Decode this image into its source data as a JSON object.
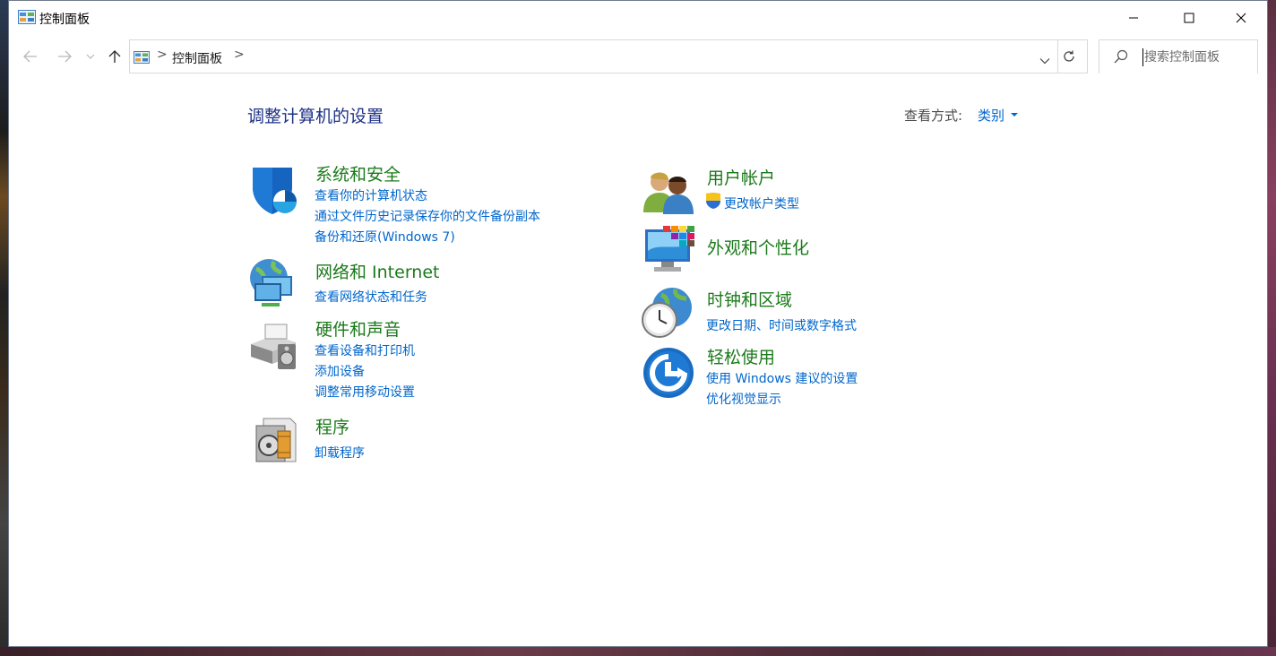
{
  "window": {
    "title": "控制面板"
  },
  "address": {
    "crumb": "控制面板",
    "separator": ">"
  },
  "search": {
    "placeholder": "搜索控制面板"
  },
  "header": {
    "heading": "调整计算机的设置",
    "view_by_label": "查看方式:",
    "view_by_value": "类别"
  },
  "categories": {
    "system": {
      "title": "系统和安全",
      "links": [
        "查看你的计算机状态",
        "通过文件历史记录保存你的文件备份副本",
        "备份和还原(Windows 7)"
      ]
    },
    "network": {
      "title": "网络和 Internet",
      "links": [
        "查看网络状态和任务"
      ]
    },
    "hardware": {
      "title": "硬件和声音",
      "links": [
        "查看设备和打印机",
        "添加设备",
        "调整常用移动设置"
      ]
    },
    "programs": {
      "title": "程序",
      "links": [
        "卸载程序"
      ]
    },
    "users": {
      "title": "用户帐户",
      "links": [
        "更改帐户类型"
      ]
    },
    "appearance": {
      "title": "外观和个性化",
      "links": []
    },
    "clock": {
      "title": "时钟和区域",
      "links": [
        "更改日期、时间或数字格式"
      ]
    },
    "ease": {
      "title": "轻松使用",
      "links": [
        "使用 Windows 建议的设置",
        "优化视觉显示"
      ]
    }
  },
  "icons": {
    "title": "control-panel-icon",
    "back": "arrow-left-icon",
    "forward": "arrow-right-icon",
    "recent": "chevron-down-icon",
    "up": "arrow-up-icon",
    "dropdown": "chevron-down-icon",
    "refresh": "refresh-icon",
    "search": "search-icon"
  },
  "colors": {
    "heading": "#1e3287",
    "category_title": "#1b7a1b",
    "link": "#0066cc"
  }
}
